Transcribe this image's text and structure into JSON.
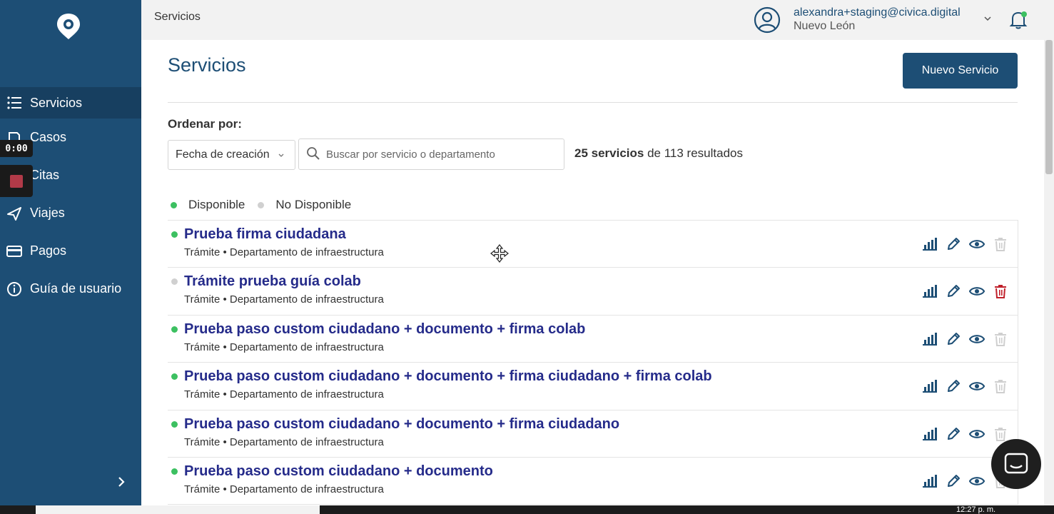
{
  "sidebar": {
    "items": [
      {
        "label": "Servicios",
        "icon": "list-icon",
        "active": true
      },
      {
        "label": "Casos",
        "icon": "cases-icon",
        "active": false
      },
      {
        "label": "Citas",
        "icon": "calendar-icon",
        "active": false
      },
      {
        "label": "Viajes",
        "icon": "plane-icon",
        "active": false
      },
      {
        "label": "Pagos",
        "icon": "credit-card-icon",
        "active": false
      },
      {
        "label": "Guía de usuario",
        "icon": "info-icon",
        "active": false
      }
    ]
  },
  "recorder": {
    "timer": "0:00"
  },
  "header": {
    "breadcrumb": "Servicios",
    "user_email": "alexandra+staging@civica.digital",
    "user_state": "Nuevo León"
  },
  "main": {
    "title": "Servicios",
    "new_button": "Nuevo Servicio",
    "sort_label": "Ordenar por:",
    "sort_value": "Fecha de creación",
    "search_placeholder": "Buscar por servicio o departamento",
    "results_count": "25 servicios",
    "results_rest": " de 113 resultados",
    "legend": {
      "available": "Disponible",
      "unavailable": "No Disponible"
    }
  },
  "services": [
    {
      "name": "Prueba firma ciudadana",
      "type": "Trámite",
      "dept": "Departamento de infraestructura",
      "available": true,
      "deletable": false
    },
    {
      "name": "Trámite prueba guía colab",
      "type": "Trámite",
      "dept": "Departamento de infraestructura",
      "available": false,
      "deletable": true
    },
    {
      "name": "Prueba paso custom ciudadano + documento + firma colab",
      "type": "Trámite",
      "dept": "Departamento de infraestructura",
      "available": true,
      "deletable": false
    },
    {
      "name": "Prueba paso custom ciudadano + documento + firma ciudadano + firma colab",
      "type": "Trámite",
      "dept": "Departamento de infraestructura",
      "available": true,
      "deletable": false
    },
    {
      "name": "Prueba paso custom ciudadano + documento + firma ciudadano",
      "type": "Trámite",
      "dept": "Departamento de infraestructura",
      "available": true,
      "deletable": false
    },
    {
      "name": "Prueba paso custom ciudadano + documento",
      "type": "Trámite",
      "dept": "Departamento de infraestructura",
      "available": true,
      "deletable": false
    }
  ],
  "colors": {
    "primary": "#1d4e75",
    "link": "#252b8a",
    "available": "#3cc061",
    "unavailable": "#d0d0d0",
    "danger": "#c0202a"
  },
  "taskbar": {
    "clock": "12:27 p. m."
  }
}
